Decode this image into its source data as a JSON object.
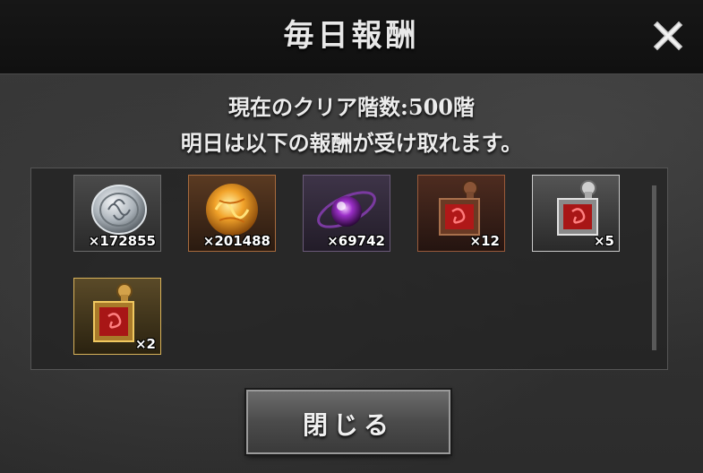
{
  "dialog": {
    "title": "毎日報酬",
    "line1": "現在のクリア階数:500階",
    "line2": "明日は以下の報酬が受け取れます。",
    "close_button": "閉じる",
    "close_icon": "close-x-icon"
  },
  "rewards": [
    {
      "icon": "silver-coin-icon",
      "count": "×172855",
      "frame": "silver-grey"
    },
    {
      "icon": "gold-orb-icon",
      "count": "×201488",
      "frame": "orange"
    },
    {
      "icon": "purple-orb-icon",
      "count": "×69742",
      "frame": "purple"
    },
    {
      "icon": "red-stamp-bronze-icon",
      "count": "×12",
      "frame": "brown"
    },
    {
      "icon": "red-stamp-silver-icon",
      "count": "×5",
      "frame": "silver"
    },
    {
      "icon": "red-stamp-gold-icon",
      "count": "×2",
      "frame": "gold"
    }
  ],
  "colors": {
    "title_bar": "#121212",
    "text": "#ececec",
    "panel": "#232323"
  }
}
